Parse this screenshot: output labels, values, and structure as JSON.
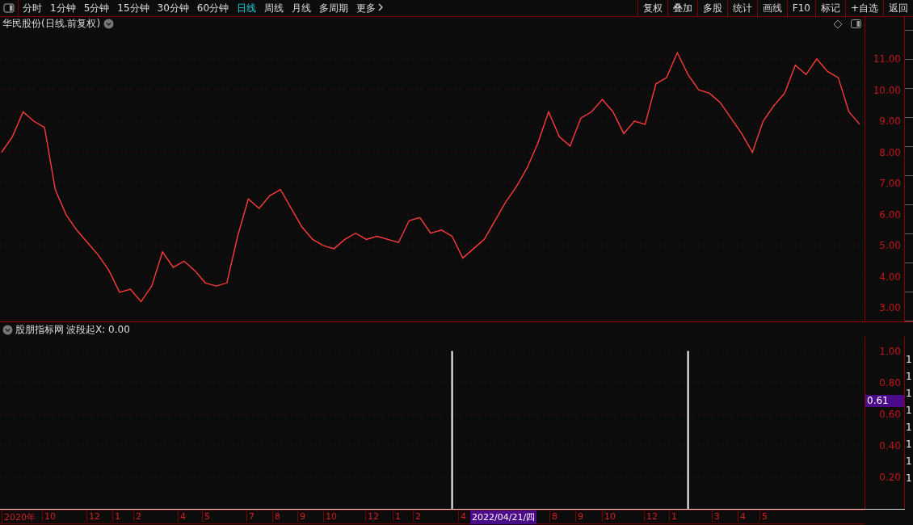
{
  "toolbar": {
    "periods": [
      {
        "label": "分时",
        "selected": false
      },
      {
        "label": "1分钟",
        "selected": false
      },
      {
        "label": "5分钟",
        "selected": false
      },
      {
        "label": "15分钟",
        "selected": false
      },
      {
        "label": "30分钟",
        "selected": false
      },
      {
        "label": "60分钟",
        "selected": false
      },
      {
        "label": "日线",
        "selected": true
      },
      {
        "label": "周线",
        "selected": false
      },
      {
        "label": "月线",
        "selected": false
      },
      {
        "label": "多周期",
        "selected": false
      },
      {
        "label": "更多",
        "selected": false
      }
    ],
    "actions": [
      "复权",
      "叠加",
      "多股",
      "统计",
      "画线",
      "F10",
      "标记",
      "+自选",
      "返回"
    ]
  },
  "price_panel": {
    "title": "华民股份(日线.前复权)",
    "chart_data": {
      "type": "line",
      "grid": true,
      "ylim": [
        2.56,
        11.91
      ],
      "yticks": [
        {
          "value": 3,
          "label": "3.00"
        },
        {
          "value": 4,
          "label": "4.00"
        },
        {
          "value": 5,
          "label": "5.00"
        },
        {
          "value": 6,
          "label": "6.00"
        },
        {
          "value": 7,
          "label": "7.00"
        },
        {
          "value": 8,
          "label": "8.00"
        },
        {
          "value": 9,
          "label": "9.00"
        },
        {
          "value": 10,
          "label": "10.00"
        },
        {
          "value": 11,
          "label": "11.00"
        }
      ],
      "series": [
        {
          "color": "#ff3b3b",
          "values": [
            8.0,
            8.5,
            9.3,
            9.0,
            8.8,
            6.8,
            6.0,
            5.5,
            5.1,
            4.7,
            4.2,
            3.5,
            3.6,
            3.2,
            3.7,
            4.8,
            4.3,
            4.5,
            4.2,
            3.8,
            3.7,
            3.8,
            5.3,
            6.5,
            6.2,
            6.6,
            6.8,
            6.2,
            5.6,
            5.2,
            5.0,
            4.9,
            5.2,
            5.4,
            5.2,
            5.3,
            5.2,
            5.1,
            5.8,
            5.9,
            5.4,
            5.5,
            5.3,
            4.6,
            4.9,
            5.2,
            5.8,
            6.4,
            6.9,
            7.5,
            8.3,
            9.3,
            8.5,
            8.2,
            9.1,
            9.3,
            9.7,
            9.3,
            8.6,
            9.0,
            8.9,
            10.2,
            10.4,
            11.2,
            10.5,
            10.0,
            9.9,
            9.6,
            9.1,
            8.6,
            8.0,
            9.0,
            9.5,
            9.9,
            10.8,
            10.5,
            11.0,
            10.6,
            10.4,
            9.3,
            8.9
          ]
        }
      ]
    }
  },
  "indicator_panel": {
    "name": "股朋指标网",
    "reading": "波段起X: 0.00",
    "cursor_value": "0.61",
    "chart_data": {
      "type": "bar",
      "grid": true,
      "ylim": [
        0,
        1.09
      ],
      "yticks": [
        {
          "value": 0.2,
          "label": "0.20"
        },
        {
          "value": 0.4,
          "label": "0.40"
        },
        {
          "value": 0.6,
          "label": "0.60"
        },
        {
          "value": 0.8,
          "label": "0.80"
        },
        {
          "value": 1,
          "label": "1.00"
        }
      ],
      "series": [
        {
          "color": "#ffffff",
          "values": [
            0,
            0,
            0,
            0,
            0,
            0,
            0,
            0,
            0,
            0,
            0,
            0,
            0,
            0,
            0,
            0,
            0,
            0,
            0,
            0,
            0,
            0,
            0,
            0,
            0,
            0,
            0,
            0,
            0,
            0,
            0,
            0,
            0,
            0,
            0,
            0,
            0,
            0,
            0,
            0,
            0,
            0,
            1,
            0,
            0,
            0,
            0,
            0,
            0,
            0,
            0,
            0,
            0,
            0,
            0,
            0,
            0,
            0,
            0,
            0,
            0,
            0,
            0,
            0,
            1,
            0,
            0,
            0,
            0,
            0,
            0,
            0,
            0,
            0,
            0,
            0,
            0,
            0,
            0,
            0,
            0
          ]
        }
      ]
    }
  },
  "date_axis": {
    "labels": [
      "2020年",
      "10",
      "12",
      "1",
      "2",
      "4",
      "5",
      "7",
      "8",
      "9",
      "10",
      "12",
      "1",
      "2",
      "4",
      "8",
      "9",
      "10",
      "12",
      "1",
      "3",
      "4",
      "5"
    ],
    "cursor_date": "2022/04/21/四"
  },
  "side_strip": {
    "items": [
      "1",
      "1",
      "1",
      "1",
      "1",
      "1",
      "1",
      "1"
    ]
  }
}
